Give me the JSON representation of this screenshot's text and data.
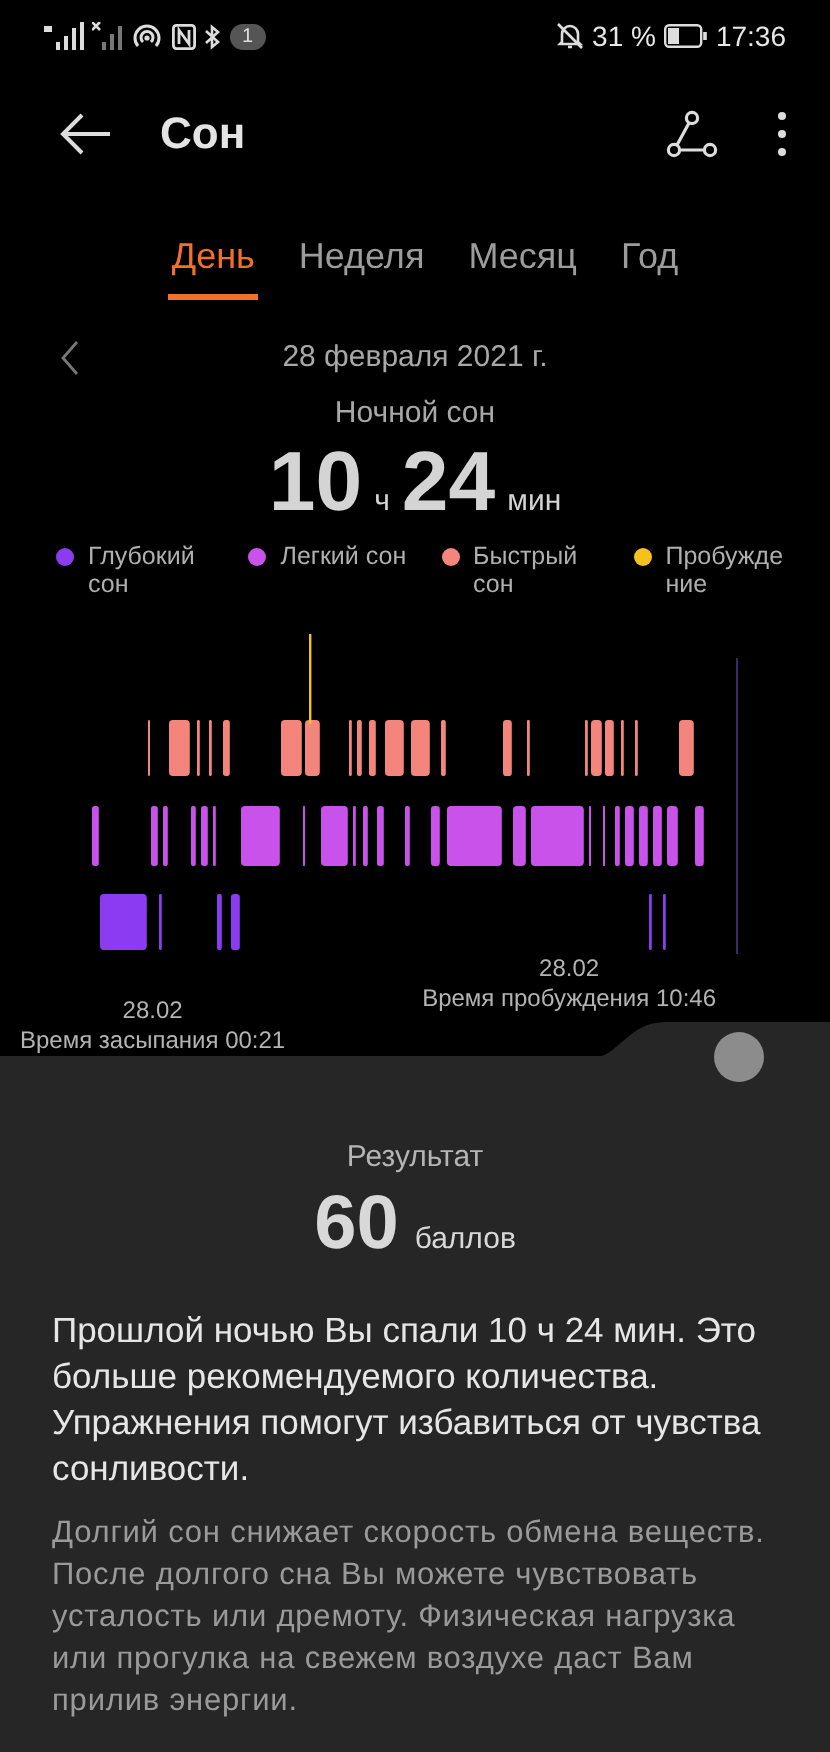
{
  "status_bar": {
    "notification_count": "1",
    "battery": "31 %",
    "time": "17:36"
  },
  "app_bar": {
    "title": "Сон"
  },
  "tabs": [
    {
      "label": "День",
      "selected": true
    },
    {
      "label": "Неделя",
      "selected": false
    },
    {
      "label": "Месяц",
      "selected": false
    },
    {
      "label": "Год",
      "selected": false
    }
  ],
  "date": "28 февраля 2021 г.",
  "summary": {
    "label": "Ночной сон",
    "hours": "10",
    "hours_unit": "ч",
    "minutes": "24",
    "minutes_unit": "мин"
  },
  "legend": [
    {
      "label": "Глубокий сон",
      "color": "#8b3cf2"
    },
    {
      "label": "Легкий сон",
      "color": "#c952ea"
    },
    {
      "label": "Быстрый сон",
      "color": "#f4857c"
    },
    {
      "label": "Пробуждение",
      "color": "#f5c21b"
    }
  ],
  "sleep_start": {
    "date": "28.02",
    "label": "Время засыпания 00:21"
  },
  "wake_up": {
    "date": "28.02",
    "label": "Время пробуждения 10:46"
  },
  "result": {
    "label": "Результат",
    "score": "60",
    "unit": "баллов",
    "summary": "Прошлой ночью Вы спали 10 ч 24 мин. Это больше рекомендуемого количества. Упражнения помогут избавиться от чувства сонливости.",
    "details": "Долгий сон снижает скорость обмена веществ. После долгого сна Вы можете чувствовать усталость или дремоту. Физическая нагрузка или прогулка на свежем воздухе даст Вам прилив энергии."
  }
}
